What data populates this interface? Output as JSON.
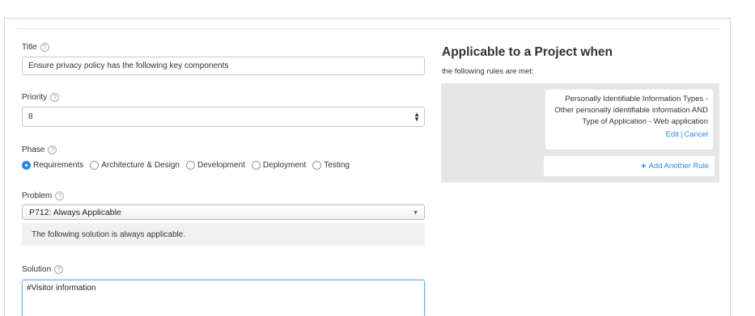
{
  "form": {
    "title_label": "Title",
    "title_value": "Ensure privacy policy has the following key components",
    "priority_label": "Priority",
    "priority_value": "8",
    "phase_label": "Phase",
    "phases": [
      {
        "label": "Requirements",
        "checked": true
      },
      {
        "label": "Architecture & Design",
        "checked": false
      },
      {
        "label": "Development",
        "checked": false
      },
      {
        "label": "Deployment",
        "checked": false
      },
      {
        "label": "Testing",
        "checked": false
      }
    ],
    "problem_label": "Problem",
    "problem_value": "P712: Always Applicable",
    "problem_description": "The following solution is always applicable.",
    "solution_label": "Solution",
    "solution_value": "#Visitor information",
    "help_glyph": "?"
  },
  "applicability": {
    "heading": "Applicable to a Project when",
    "subheading": "the following rules are met:",
    "rule_lines": [
      "Personally Identifiable Information Types -",
      "Other personally identifiable information   AND",
      "Type of Application - Web application"
    ],
    "edit_label": "Edit",
    "cancel_label": "Cancel",
    "separator": "|",
    "add_rule_label": "Add Another Rule",
    "add_rule_icon": "+"
  },
  "colors": {
    "accent": "#2a8ae0",
    "rules_background": "#e6e6e6"
  }
}
